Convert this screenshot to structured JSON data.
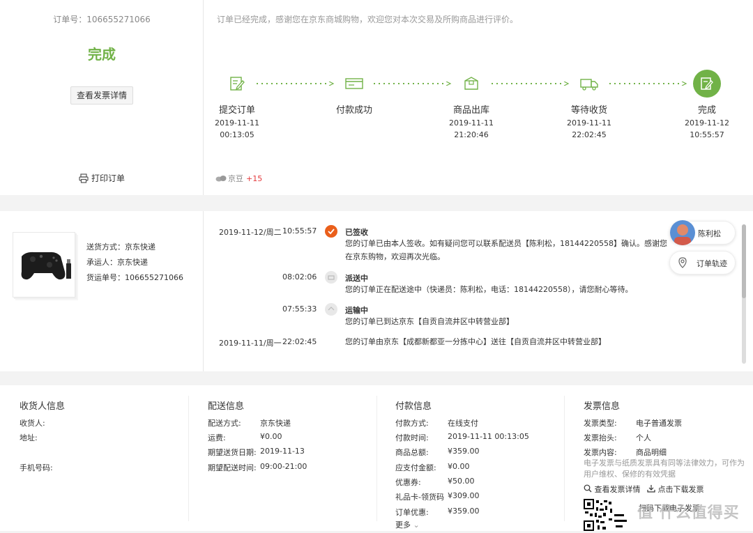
{
  "order": {
    "number_label": "订单号：106655271066",
    "status": "完成",
    "invoice_button": "查看发票详情",
    "print": "打印订单",
    "thanks": "订单已经完成，感谢您在京东商城购物，欢迎您对本次交易及所购商品进行评价。",
    "jd_label": "京豆",
    "jd_value": "+15"
  },
  "steps": [
    {
      "label": "提交订单",
      "date": "2019-11-11",
      "time": "00:13:05"
    },
    {
      "label": "付款成功",
      "date": "",
      "time": ""
    },
    {
      "label": "商品出库",
      "date": "2019-11-11",
      "time": "21:20:46"
    },
    {
      "label": "等待收货",
      "date": "2019-11-11",
      "time": "22:02:45"
    },
    {
      "label": "完成",
      "date": "2019-11-12",
      "time": "10:55:57"
    }
  ],
  "shipping": {
    "method": "送货方式：京东快递",
    "carrier": "承运人：京东快递",
    "tracking": "货运单号：106655271066"
  },
  "tracking_events": [
    {
      "date": "2019-11-12/周二",
      "time": "10:55:57",
      "title": "已签收",
      "text": "您的订单已由本人签收。如有疑问您可以联系配送员【陈利松，18144220558】确认。感谢您在京东购物，欢迎再次光临。"
    },
    {
      "date": "",
      "time": "08:02:06",
      "title": "派送中",
      "text": "您的订单正在配送途中（快递员：陈利松，电话：18144220558），请您耐心等待。"
    },
    {
      "date": "",
      "time": "07:55:33",
      "title": "运输中",
      "text": "您的订单已到达京东【自贡自流井区中转营业部】"
    },
    {
      "date": "2019-11-11/周一",
      "time": "22:02:45",
      "title": "",
      "text": "您的订单由京东【成都新都亚一分拣中心】送往【自贡自流井区中转营业部】"
    }
  ],
  "courier": {
    "name": "陈利松",
    "track_button": "订单轨迹"
  },
  "receiver": {
    "heading": "收货人信息",
    "name_label": "收货人:",
    "address_label": "地址:",
    "phone_label": "手机号码:"
  },
  "delivery": {
    "heading": "配送信息",
    "rows": [
      {
        "k": "配送方式:",
        "v": "京东快递"
      },
      {
        "k": "运费:",
        "v": "¥0.00"
      },
      {
        "k": "期望送货日期:",
        "v": "2019-11-13"
      },
      {
        "k": "期望配送时间:",
        "v": "09:00-21:00"
      }
    ]
  },
  "payment": {
    "heading": "付款信息",
    "rows": [
      {
        "k": "付款方式:",
        "v": "在线支付"
      },
      {
        "k": "付款时间:",
        "v": "2019-11-11 00:13:05"
      },
      {
        "k": "商品总额:",
        "v": "¥359.00"
      },
      {
        "k": "应支付金额:",
        "v": "¥0.00"
      },
      {
        "k": "优惠券:",
        "v": "¥50.00"
      },
      {
        "k": "礼品卡-领货码",
        "v": "¥309.00"
      },
      {
        "k": "订单优惠:",
        "v": "¥359.00"
      }
    ],
    "more": "更多"
  },
  "invoice": {
    "heading": "发票信息",
    "rows": [
      {
        "k": "发票类型:",
        "v": "电子普通发票"
      },
      {
        "k": "发票抬头:",
        "v": "个人"
      },
      {
        "k": "发票内容:",
        "v": "商品明细"
      }
    ],
    "note": "电子发票与纸质发票具有同等法律效力，可作为用户维权、保修的有效凭据",
    "view_link": "查看发票详情",
    "download_link": "点击下载发票",
    "qr_text": "扫码下载电子发票"
  },
  "watermark": "值 什么值得买",
  "colors": {
    "accent_green": "#71b247",
    "signed_orange": "#ea5f1b",
    "jd_red": "#e4393c"
  }
}
